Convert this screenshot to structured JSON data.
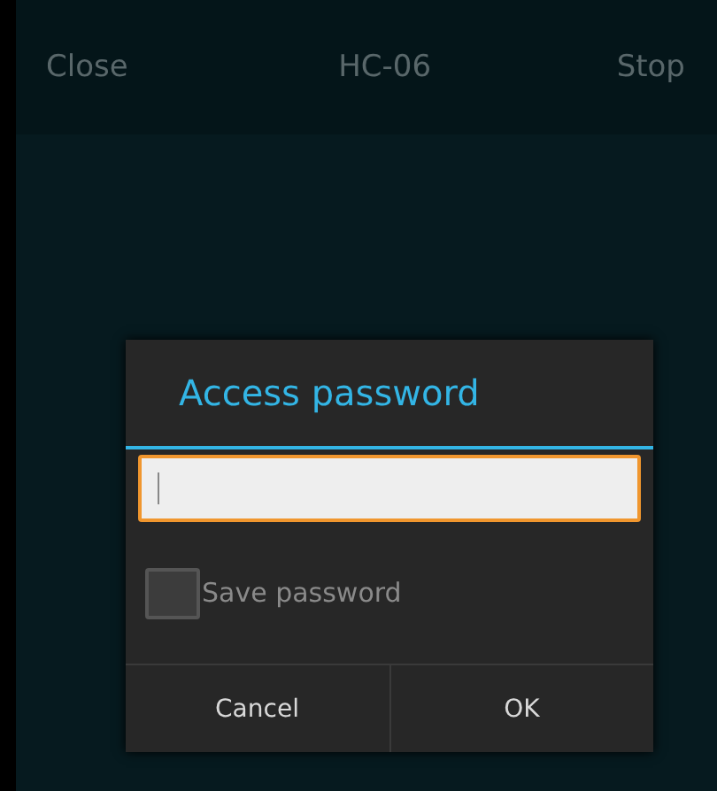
{
  "top_bar": {
    "left_action": "Close",
    "title": "HC-06",
    "right_action": "Stop"
  },
  "dialog": {
    "title": "Access password",
    "save_password": {
      "label": "Save password",
      "checked": false
    },
    "buttons": [
      "Cancel",
      "OK"
    ]
  }
}
